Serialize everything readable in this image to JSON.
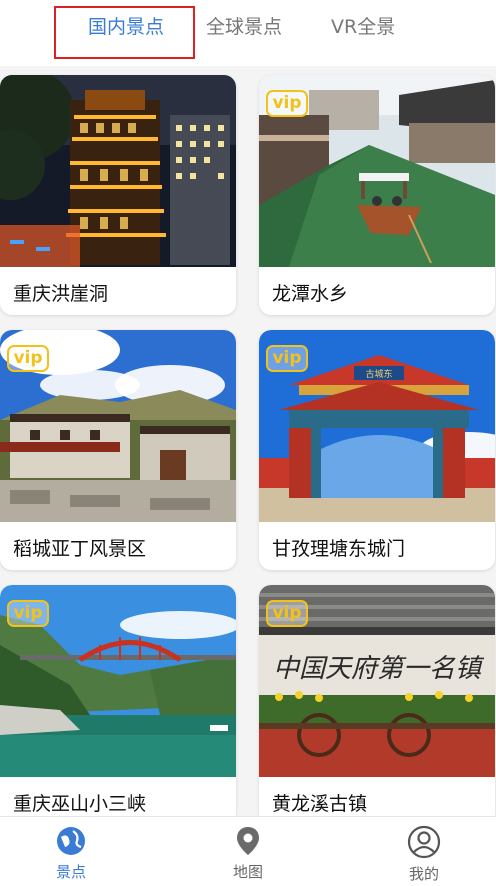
{
  "tabs": {
    "items": [
      {
        "label": "国内景点",
        "active": true
      },
      {
        "label": "全球景点",
        "active": false
      },
      {
        "label": "VR全景",
        "active": false
      }
    ]
  },
  "cards": [
    {
      "title": "重庆洪崖洞",
      "vip": false
    },
    {
      "title": "龙潭水乡",
      "vip": true,
      "badge": "vip"
    },
    {
      "title": "稻城亚丁风景区",
      "vip": true,
      "badge": "vip"
    },
    {
      "title": "甘孜理塘东城门",
      "vip": true,
      "badge": "vip"
    },
    {
      "title": "重庆巫山小三峡",
      "vip": true,
      "badge": "vip"
    },
    {
      "title": "黄龙溪古镇",
      "vip": true,
      "badge": "vip"
    }
  ],
  "photo_texts": {
    "gate_plaque": "古城东",
    "wall_inscription": "中国天府第一名镇"
  },
  "bottom_nav": {
    "items": [
      {
        "label": "景点",
        "icon": "globe-icon",
        "active": true
      },
      {
        "label": "地图",
        "icon": "map-pin-icon",
        "active": false
      },
      {
        "label": "我的",
        "icon": "user-icon",
        "active": false
      }
    ]
  },
  "colors": {
    "accent": "#3a7bd5",
    "vip_badge": "#f2c21a",
    "highlight_box": "#e02020"
  }
}
